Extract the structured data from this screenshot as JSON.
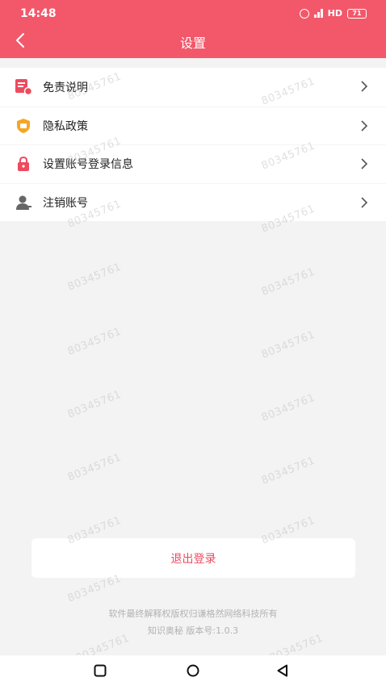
{
  "status_bar": {
    "time": "14:48",
    "network": "HD",
    "battery": "71"
  },
  "header": {
    "title": "设置"
  },
  "menu": {
    "items": [
      {
        "label": "免责说明",
        "icon": "document-icon"
      },
      {
        "label": "隐私政策",
        "icon": "shield-icon"
      },
      {
        "label": "设置账号登录信息",
        "icon": "lock-icon"
      },
      {
        "label": "注销账号",
        "icon": "user-icon"
      }
    ]
  },
  "logout_label": "退出登录",
  "footer": {
    "copyright": "软件最终解释权版权归谦格然网络科技所有",
    "version": "知识奥秘 版本号:1.0.3"
  },
  "watermark": "80345761",
  "colors": {
    "brand": "#f2586a",
    "accent": "#ee4a5e",
    "shield": "#f5a623"
  }
}
